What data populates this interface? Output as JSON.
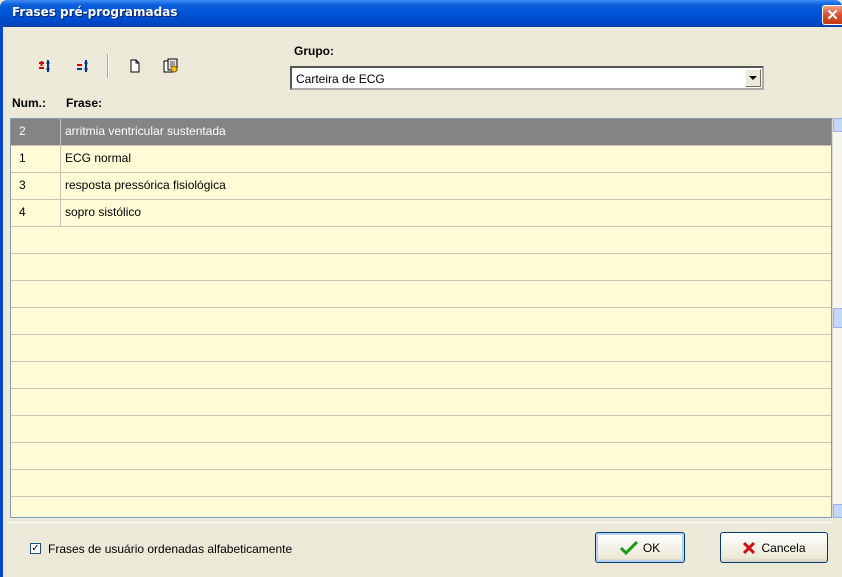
{
  "window": {
    "title": "Frases pré-programadas",
    "close_symbol": "✕"
  },
  "toolbar": {
    "buttons": [
      {
        "icon": "insert-row-icon"
      },
      {
        "icon": "remove-row-icon"
      },
      {
        "icon": "new-document-icon"
      },
      {
        "icon": "copy-document-icon"
      }
    ]
  },
  "grupo": {
    "label": "Grupo:",
    "value": "Carteira de ECG"
  },
  "columns": {
    "num": "Num.:",
    "frase": "Frase:"
  },
  "rows": [
    {
      "num": "2",
      "frase": "arritmia ventricular sustentada",
      "selected": true
    },
    {
      "num": "1",
      "frase": "ECG normal"
    },
    {
      "num": "3",
      "frase": "resposta pressórica fisiológica"
    },
    {
      "num": "4",
      "frase": "sopro sistólico"
    }
  ],
  "footer": {
    "checkbox_label": "Frases de usuário ordenadas alfabeticamente",
    "checkbox_checked": true,
    "checkbox_mark": "✓",
    "ok_label": "OK",
    "cancel_label": "Cancela"
  },
  "colors": {
    "grid_background": "#fffbd6",
    "selected_row": "#848484",
    "titlebar": "#0052d6"
  }
}
